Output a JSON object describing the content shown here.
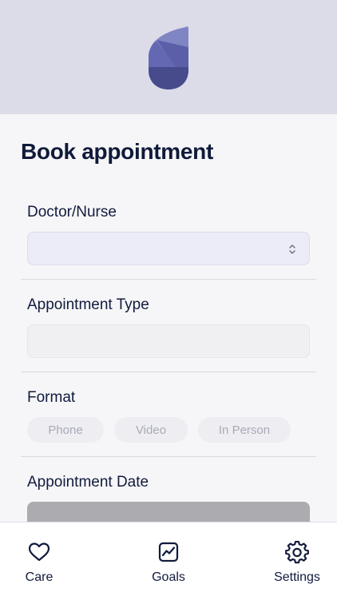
{
  "page": {
    "title": "Book appointment"
  },
  "form": {
    "doctor": {
      "label": "Doctor/Nurse",
      "value": ""
    },
    "appointment_type": {
      "label": "Appointment Type",
      "value": ""
    },
    "format": {
      "label": "Format",
      "options": [
        "Phone",
        "Video",
        "In Person"
      ]
    },
    "appointment_date": {
      "label": "Appointment Date"
    }
  },
  "tabbar": {
    "care": {
      "label": "Care",
      "icon": "heart-icon"
    },
    "goals": {
      "label": "Goals",
      "icon": "chart-icon"
    },
    "settings": {
      "label": "Settings",
      "icon": "gear-icon"
    }
  },
  "colors": {
    "header_bg": "#dcdce9",
    "brand": "#5a5fa8",
    "text": "#111b3d"
  }
}
